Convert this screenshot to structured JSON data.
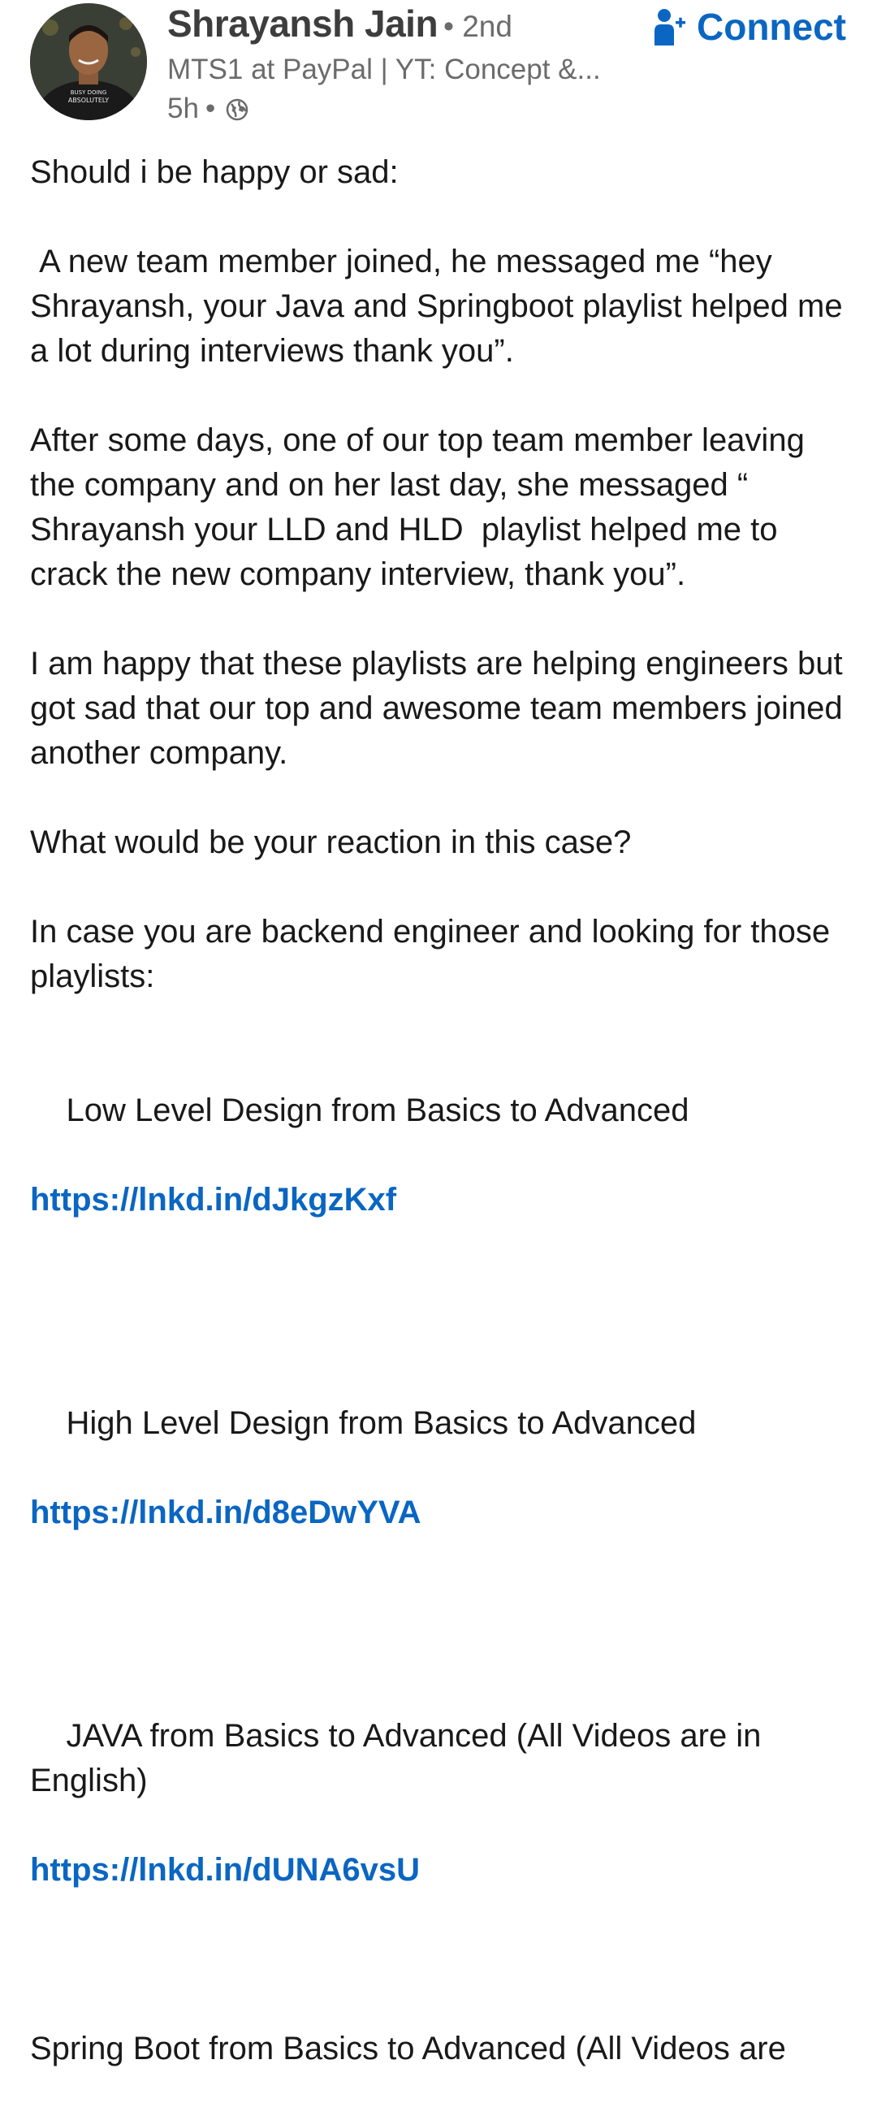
{
  "author": {
    "name": "Shrayansh Jain",
    "degree": "• 2nd",
    "headline": "MTS1 at PayPal | YT: Concept &...",
    "time": "5h",
    "separator": "•",
    "visibility_icon": "globe-icon",
    "avatar_shirt_text": [
      "BUSY DOING",
      "ABSOLUTELY"
    ]
  },
  "actions": {
    "connect_label": "Connect",
    "connect_icon": "add-person-icon"
  },
  "post": {
    "intro": "Should i be happy or sad:",
    "para1": " A new team member joined, he messaged me “hey Shrayansh, your Java and Springboot playlist helped me a lot during interviews thank you”.",
    "para2": "After some days, one of our top team member leaving the company and on her last day, she messaged “ Shrayansh your LLD and HLD  playlist helped me to crack the new company interview, thank you”.",
    "para3": "I am happy that these playlists are helping engineers but got sad that our top and awesome team members joined another company.",
    "para4": "What would be your reaction in this case?",
    "para5": "In case you are backend engineer and looking for those playlists:",
    "playlists": [
      {
        "title": "Low Level Design from Basics to Advanced",
        "url": "https://lnkd.in/dJkgzKxf"
      },
      {
        "title": "High Level Design from Basics to Advanced",
        "url": "https://lnkd.in/d8eDwYVA"
      },
      {
        "title": "JAVA from Basics to Advanced (All Videos are in English)",
        "url": "https://lnkd.in/dUNA6vsU"
      }
    ],
    "last_line": "Spring Boot from Basics to Advanced (All Videos are"
  },
  "colors": {
    "link": "#0a66c2",
    "text": "#191919",
    "muted": "#6b6b6b"
  }
}
